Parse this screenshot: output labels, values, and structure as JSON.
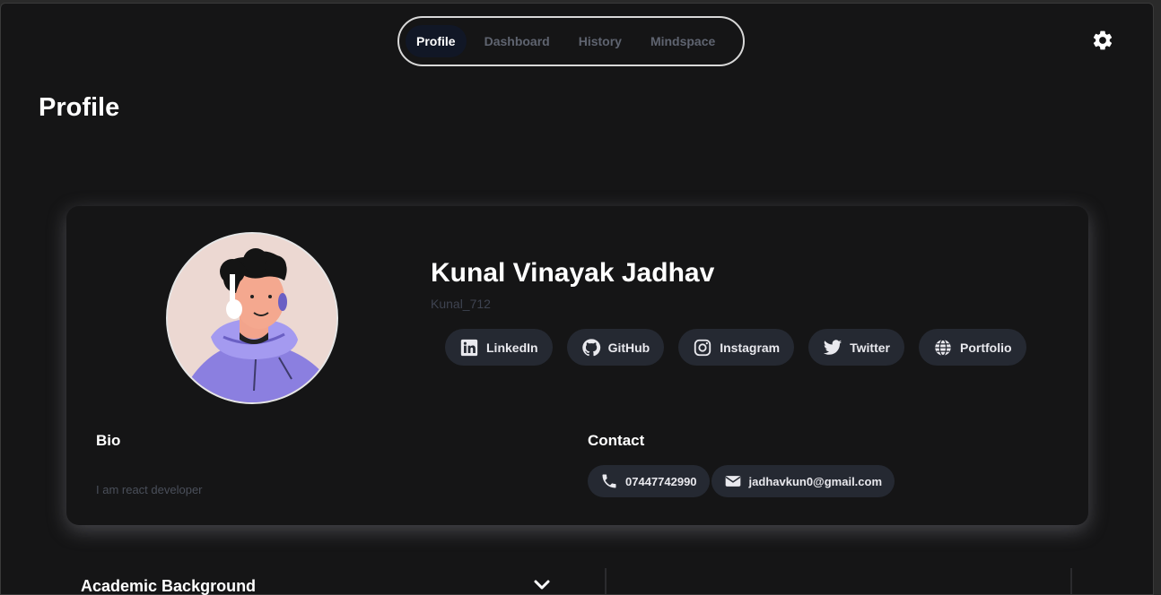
{
  "nav": {
    "tabs": [
      {
        "label": "Profile",
        "active": true
      },
      {
        "label": "Dashboard",
        "active": false
      },
      {
        "label": "History",
        "active": false
      },
      {
        "label": "Mindspace",
        "active": false
      }
    ],
    "settings_icon": "gear-icon"
  },
  "page": {
    "title": "Profile"
  },
  "profile": {
    "name": "Kunal Vinayak Jadhav",
    "username": "Kunal_712",
    "socials": [
      {
        "label": "LinkedIn",
        "icon": "linkedin-icon"
      },
      {
        "label": "GitHub",
        "icon": "github-icon"
      },
      {
        "label": "Instagram",
        "icon": "instagram-icon"
      },
      {
        "label": "Twitter",
        "icon": "twitter-icon"
      },
      {
        "label": "Portfolio",
        "icon": "globe-icon"
      }
    ]
  },
  "bio": {
    "heading": "Bio",
    "text": "I am react developer"
  },
  "contact": {
    "heading": "Contact",
    "phone": "07447742990",
    "email": "jadhavkun0@gmail.com"
  },
  "academic": {
    "heading": "Academic Background"
  },
  "colors": {
    "background": "#151516",
    "pill": "#252932",
    "active_tab": "#111726",
    "avatar_hoodie": "#8b7fe0"
  }
}
